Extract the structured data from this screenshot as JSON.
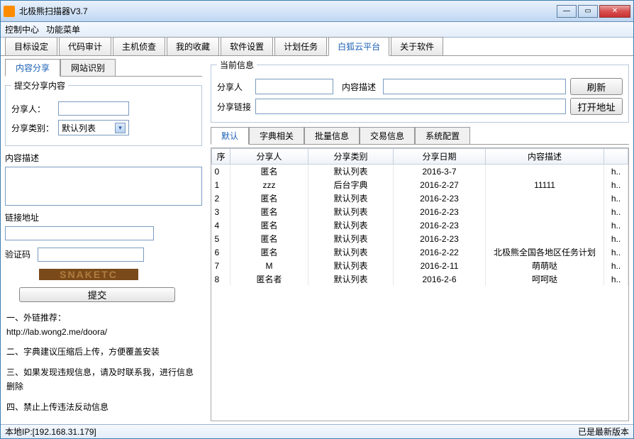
{
  "title": "北极熊扫描器V3.7",
  "menus": [
    "控制中心",
    "功能菜单"
  ],
  "main_tabs": [
    "目标设定",
    "代码审计",
    "主机侦查",
    "我的收藏",
    "软件设置",
    "计划任务",
    "白狐云平台",
    "关于软件"
  ],
  "main_tab_active": 6,
  "sub_tabs": [
    "内容分享",
    "网站识别"
  ],
  "sub_tab_active": 0,
  "form": {
    "legend": "提交分享内容",
    "sharer_label": "分享人：",
    "category_label": "分享类别：",
    "category_value": "默认列表",
    "desc_label": "内容描述",
    "link_label": "链接地址",
    "captcha_label": "验证码",
    "captcha_text": "SNAKETC",
    "submit": "提交"
  },
  "notes": [
    "一、外链推荐：",
    "http://lab.wong2.me/doora/",
    "二、字典建议压缩后上传，方便覆盖安装",
    "三、如果发现违规信息，请及时联系我，进行信息删除",
    "四、禁止上传违法反动信息"
  ],
  "current": {
    "legend": "当前信息",
    "sharer_label": "分享人",
    "desc_label": "内容描述",
    "link_label": "分享链接",
    "refresh": "刷新",
    "open": "打开地址"
  },
  "info_tabs": [
    "默认",
    "字典相关",
    "批量信息",
    "交易信息",
    "系统配置"
  ],
  "info_tab_active": 0,
  "table": {
    "headers": [
      "序",
      "分享人",
      "分享类别",
      "分享日期",
      "内容描述",
      ""
    ],
    "rows": [
      [
        "0",
        "匿名",
        "默认列表",
        "2016-3-7",
        "",
        "h.."
      ],
      [
        "1",
        "zzz",
        "后台字典",
        "2016-2-27",
        "11111",
        "h.."
      ],
      [
        "2",
        "匿名",
        "默认列表",
        "2016-2-23",
        "",
        "h.."
      ],
      [
        "3",
        "匿名",
        "默认列表",
        "2016-2-23",
        "",
        "h.."
      ],
      [
        "4",
        "匿名",
        "默认列表",
        "2016-2-23",
        "",
        "h.."
      ],
      [
        "5",
        "匿名",
        "默认列表",
        "2016-2-23",
        "",
        "h.."
      ],
      [
        "6",
        "匿名",
        "默认列表",
        "2016-2-22",
        "北极熊全国各地区任务计划",
        "h.."
      ],
      [
        "7",
        "M",
        "默认列表",
        "2016-2-11",
        "萌萌哒",
        "h.."
      ],
      [
        "8",
        "匿名者",
        "默认列表",
        "2016-2-6",
        "呵呵哒",
        "h.."
      ]
    ]
  },
  "status": {
    "ip": "本地IP:[192.168.31.179]",
    "version": "已是最新版本"
  }
}
